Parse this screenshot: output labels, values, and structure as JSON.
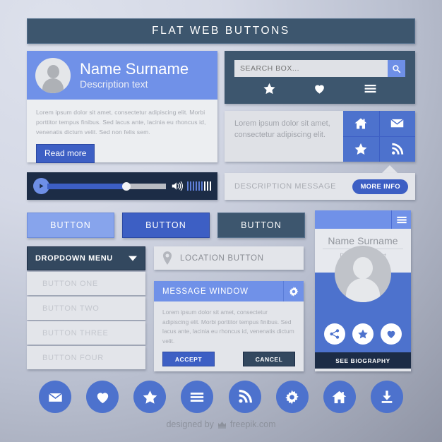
{
  "header": {
    "title": "FLAT WEB BUTTONS"
  },
  "profile_card": {
    "name": "Name Surname",
    "description": "Description text",
    "body": "Lorem ipsum dolor sit amet, consectetur adipiscing elit. Morbi porttitor tempus finibus. Sed lacus ante, lacinia eu rhoncus id, venenatis dictum velit. Sed non felis sem.",
    "button_label": "Read more",
    "avatar_icon": "user-avatar-icon"
  },
  "search_panel": {
    "placeholder": "SEARCH BOX...",
    "value": "",
    "search_icon": "search-icon",
    "icons": [
      "star-icon",
      "heart-icon",
      "hamburger-icon"
    ]
  },
  "text_icon_grid": {
    "text": "Lorem ipsum dolor sit amet, consectetur adipiscing elit.",
    "icons": [
      "home-icon",
      "envelope-icon",
      "star-icon",
      "rss-icon"
    ]
  },
  "description_message": {
    "text": "DESCRIPTION MESSAGE",
    "button_label": "MORE INFO"
  },
  "media_player": {
    "play_icon": "play-icon",
    "progress_percent": 67,
    "volume_icon": "speaker-icon",
    "volume_bars_total": 9,
    "volume_bars_active": 6
  },
  "flat_buttons": [
    {
      "label": "BUTTON",
      "color": "#87a4ec"
    },
    {
      "label": "BUTTON",
      "color": "#3d5fc4"
    },
    {
      "label": "BUTTON",
      "color": "#3d566e"
    }
  ],
  "dropdown": {
    "header_label": "DROPDOWN MENU",
    "caret_icon": "chevron-down-icon",
    "items": [
      "BUTTON ONE",
      "BUTTON TWO",
      "BUTTON THREE",
      "BUTTON FOUR"
    ]
  },
  "location_button": {
    "label": "LOCATION BUTTON",
    "icon": "map-pin-icon"
  },
  "message_window": {
    "title": "MESSAGE WINDOW",
    "gear_icon": "gear-icon",
    "body": "Lorem ipsum dolor sit amet, consectetur adipiscing elit. Morbi porttitor tempus finibus. Sed lacus ante, lacinia eu rhoncus id, venenatis dictum velit.",
    "accept_label": "ACCEPT",
    "cancel_label": "CANCEL"
  },
  "profile_card_right": {
    "menu_icon": "hamburger-icon",
    "name": "Name Surname",
    "description": "Description text",
    "avatar_icon": "user-avatar-icon",
    "social_icons": [
      "share-icon",
      "star-icon",
      "heart-icon"
    ],
    "footer_label": "SEE BIOGRAPHY"
  },
  "round_icons": [
    "envelope-icon",
    "heart-icon",
    "star-icon",
    "hamburger-icon",
    "rss-icon",
    "gear-icon",
    "home-icon",
    "download-icon"
  ],
  "footer": {
    "prefix": "designed by",
    "crown_icon": "crown-icon",
    "brand": "freepik.com"
  },
  "colors": {
    "accent_blue": "#4d72cd",
    "light_blue": "#7091e8",
    "deep_blue": "#3d5fc4",
    "dark_slate": "#3d566e",
    "navy": "#1c2c46",
    "panel_gray": "#e3e5ea"
  }
}
